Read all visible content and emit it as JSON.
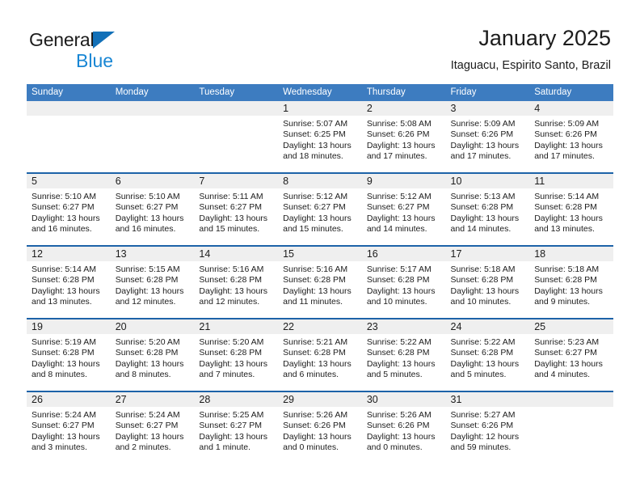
{
  "brand": {
    "name_part1": "General",
    "name_part2": "Blue",
    "triangle_icon": "triangle-icon",
    "accent_dark": "#1270b8",
    "accent_light": "#1886d4"
  },
  "header": {
    "title": "January 2025",
    "subtitle": "Itaguacu, Espirito Santo, Brazil"
  },
  "colors": {
    "header_blue": "#3d7cc0",
    "row_divider_blue": "#1d63a8",
    "daynum_band_gray": "#efefef",
    "cell_white": "#ffffff",
    "text": "#1c1c1c"
  },
  "weekday_headers": [
    "Sunday",
    "Monday",
    "Tuesday",
    "Wednesday",
    "Thursday",
    "Friday",
    "Saturday"
  ],
  "weeks": [
    [
      {
        "day": "",
        "sunrise": "",
        "sunset": "",
        "daylight_line1": "",
        "daylight_line2": ""
      },
      {
        "day": "",
        "sunrise": "",
        "sunset": "",
        "daylight_line1": "",
        "daylight_line2": ""
      },
      {
        "day": "",
        "sunrise": "",
        "sunset": "",
        "daylight_line1": "",
        "daylight_line2": ""
      },
      {
        "day": "1",
        "sunrise": "Sunrise: 5:07 AM",
        "sunset": "Sunset: 6:25 PM",
        "daylight_line1": "Daylight: 13 hours",
        "daylight_line2": "and 18 minutes."
      },
      {
        "day": "2",
        "sunrise": "Sunrise: 5:08 AM",
        "sunset": "Sunset: 6:26 PM",
        "daylight_line1": "Daylight: 13 hours",
        "daylight_line2": "and 17 minutes."
      },
      {
        "day": "3",
        "sunrise": "Sunrise: 5:09 AM",
        "sunset": "Sunset: 6:26 PM",
        "daylight_line1": "Daylight: 13 hours",
        "daylight_line2": "and 17 minutes."
      },
      {
        "day": "4",
        "sunrise": "Sunrise: 5:09 AM",
        "sunset": "Sunset: 6:26 PM",
        "daylight_line1": "Daylight: 13 hours",
        "daylight_line2": "and 17 minutes."
      }
    ],
    [
      {
        "day": "5",
        "sunrise": "Sunrise: 5:10 AM",
        "sunset": "Sunset: 6:27 PM",
        "daylight_line1": "Daylight: 13 hours",
        "daylight_line2": "and 16 minutes."
      },
      {
        "day": "6",
        "sunrise": "Sunrise: 5:10 AM",
        "sunset": "Sunset: 6:27 PM",
        "daylight_line1": "Daylight: 13 hours",
        "daylight_line2": "and 16 minutes."
      },
      {
        "day": "7",
        "sunrise": "Sunrise: 5:11 AM",
        "sunset": "Sunset: 6:27 PM",
        "daylight_line1": "Daylight: 13 hours",
        "daylight_line2": "and 15 minutes."
      },
      {
        "day": "8",
        "sunrise": "Sunrise: 5:12 AM",
        "sunset": "Sunset: 6:27 PM",
        "daylight_line1": "Daylight: 13 hours",
        "daylight_line2": "and 15 minutes."
      },
      {
        "day": "9",
        "sunrise": "Sunrise: 5:12 AM",
        "sunset": "Sunset: 6:27 PM",
        "daylight_line1": "Daylight: 13 hours",
        "daylight_line2": "and 14 minutes."
      },
      {
        "day": "10",
        "sunrise": "Sunrise: 5:13 AM",
        "sunset": "Sunset: 6:28 PM",
        "daylight_line1": "Daylight: 13 hours",
        "daylight_line2": "and 14 minutes."
      },
      {
        "day": "11",
        "sunrise": "Sunrise: 5:14 AM",
        "sunset": "Sunset: 6:28 PM",
        "daylight_line1": "Daylight: 13 hours",
        "daylight_line2": "and 13 minutes."
      }
    ],
    [
      {
        "day": "12",
        "sunrise": "Sunrise: 5:14 AM",
        "sunset": "Sunset: 6:28 PM",
        "daylight_line1": "Daylight: 13 hours",
        "daylight_line2": "and 13 minutes."
      },
      {
        "day": "13",
        "sunrise": "Sunrise: 5:15 AM",
        "sunset": "Sunset: 6:28 PM",
        "daylight_line1": "Daylight: 13 hours",
        "daylight_line2": "and 12 minutes."
      },
      {
        "day": "14",
        "sunrise": "Sunrise: 5:16 AM",
        "sunset": "Sunset: 6:28 PM",
        "daylight_line1": "Daylight: 13 hours",
        "daylight_line2": "and 12 minutes."
      },
      {
        "day": "15",
        "sunrise": "Sunrise: 5:16 AM",
        "sunset": "Sunset: 6:28 PM",
        "daylight_line1": "Daylight: 13 hours",
        "daylight_line2": "and 11 minutes."
      },
      {
        "day": "16",
        "sunrise": "Sunrise: 5:17 AM",
        "sunset": "Sunset: 6:28 PM",
        "daylight_line1": "Daylight: 13 hours",
        "daylight_line2": "and 10 minutes."
      },
      {
        "day": "17",
        "sunrise": "Sunrise: 5:18 AM",
        "sunset": "Sunset: 6:28 PM",
        "daylight_line1": "Daylight: 13 hours",
        "daylight_line2": "and 10 minutes."
      },
      {
        "day": "18",
        "sunrise": "Sunrise: 5:18 AM",
        "sunset": "Sunset: 6:28 PM",
        "daylight_line1": "Daylight: 13 hours",
        "daylight_line2": "and 9 minutes."
      }
    ],
    [
      {
        "day": "19",
        "sunrise": "Sunrise: 5:19 AM",
        "sunset": "Sunset: 6:28 PM",
        "daylight_line1": "Daylight: 13 hours",
        "daylight_line2": "and 8 minutes."
      },
      {
        "day": "20",
        "sunrise": "Sunrise: 5:20 AM",
        "sunset": "Sunset: 6:28 PM",
        "daylight_line1": "Daylight: 13 hours",
        "daylight_line2": "and 8 minutes."
      },
      {
        "day": "21",
        "sunrise": "Sunrise: 5:20 AM",
        "sunset": "Sunset: 6:28 PM",
        "daylight_line1": "Daylight: 13 hours",
        "daylight_line2": "and 7 minutes."
      },
      {
        "day": "22",
        "sunrise": "Sunrise: 5:21 AM",
        "sunset": "Sunset: 6:28 PM",
        "daylight_line1": "Daylight: 13 hours",
        "daylight_line2": "and 6 minutes."
      },
      {
        "day": "23",
        "sunrise": "Sunrise: 5:22 AM",
        "sunset": "Sunset: 6:28 PM",
        "daylight_line1": "Daylight: 13 hours",
        "daylight_line2": "and 5 minutes."
      },
      {
        "day": "24",
        "sunrise": "Sunrise: 5:22 AM",
        "sunset": "Sunset: 6:28 PM",
        "daylight_line1": "Daylight: 13 hours",
        "daylight_line2": "and 5 minutes."
      },
      {
        "day": "25",
        "sunrise": "Sunrise: 5:23 AM",
        "sunset": "Sunset: 6:27 PM",
        "daylight_line1": "Daylight: 13 hours",
        "daylight_line2": "and 4 minutes."
      }
    ],
    [
      {
        "day": "26",
        "sunrise": "Sunrise: 5:24 AM",
        "sunset": "Sunset: 6:27 PM",
        "daylight_line1": "Daylight: 13 hours",
        "daylight_line2": "and 3 minutes."
      },
      {
        "day": "27",
        "sunrise": "Sunrise: 5:24 AM",
        "sunset": "Sunset: 6:27 PM",
        "daylight_line1": "Daylight: 13 hours",
        "daylight_line2": "and 2 minutes."
      },
      {
        "day": "28",
        "sunrise": "Sunrise: 5:25 AM",
        "sunset": "Sunset: 6:27 PM",
        "daylight_line1": "Daylight: 13 hours",
        "daylight_line2": "and 1 minute."
      },
      {
        "day": "29",
        "sunrise": "Sunrise: 5:26 AM",
        "sunset": "Sunset: 6:26 PM",
        "daylight_line1": "Daylight: 13 hours",
        "daylight_line2": "and 0 minutes."
      },
      {
        "day": "30",
        "sunrise": "Sunrise: 5:26 AM",
        "sunset": "Sunset: 6:26 PM",
        "daylight_line1": "Daylight: 13 hours",
        "daylight_line2": "and 0 minutes."
      },
      {
        "day": "31",
        "sunrise": "Sunrise: 5:27 AM",
        "sunset": "Sunset: 6:26 PM",
        "daylight_line1": "Daylight: 12 hours",
        "daylight_line2": "and 59 minutes."
      },
      {
        "day": "",
        "sunrise": "",
        "sunset": "",
        "daylight_line1": "",
        "daylight_line2": ""
      }
    ]
  ]
}
